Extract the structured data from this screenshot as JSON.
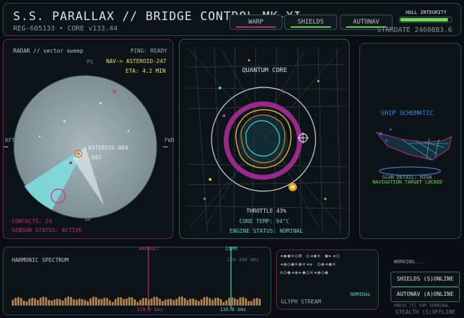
{
  "header": {
    "title": "S.S. PARALLAX // BRIDGE CONTROL MK-XI",
    "subtitle": "REG-605133 • CORE v133.44",
    "buttons": [
      {
        "label": "WARP",
        "color": "#c0306a"
      },
      {
        "label": "SHIELDS",
        "color": "#6bd65a"
      },
      {
        "label": "AUTONAV",
        "color": "#6bd65a"
      }
    ],
    "hull_label": "HULL INTEGRITY",
    "hull_level": 0.95,
    "stardate": "STARDATE 2460883.6"
  },
  "radar": {
    "title": "RADAR // sector sweep",
    "ping": "PING: READY",
    "nav": "NAV-> ASTEROID-247",
    "eta": "ETA: 4.2 MIN",
    "target_a": "ASTEROID-869",
    "target_b": "-507",
    "aft": "AFT",
    "fwd": "FWD",
    "ps": "PS",
    "sp": "SP",
    "contacts": "CONTACTS: 24",
    "sensor_status": "SENSOR STATUS: ACTIVE"
  },
  "core": {
    "title": "QUANTUM CORE",
    "throttle": "THROTTLE 43%",
    "temp": "CORE TEMP: 94°C",
    "engine": "ENGINE STATUS: NOMINAL"
  },
  "schematic": {
    "title": "SHIP SCHEMATIC",
    "scan": "SCAN DETAIL: HIGH",
    "nav_locked": "NAVIGATION TARGET LOCKED"
  },
  "spectrum": {
    "title": "HARMONIC SPECTRUM",
    "range": "120-300 GHz",
    "anomaly": "ANOMALY",
    "anomaly_freq": "129.0 GHz",
    "comm": "COMM",
    "comm_freq": "135.8 GHz"
  },
  "glyph": {
    "title": "GLYPH STREAM",
    "status": "NOMINAL",
    "row1": "◂▪◆✕◇⊗ ◇◂▪✕ ◆▸◂◇",
    "row2": "◂◈◇◆✕◈✕◂▸ ◇◈◂◆✕",
    "row3": "✕◇◆◂◈▸◆◇✕◂◈◇◆"
  },
  "side": {
    "overlay": "WORKING...",
    "shields_btn": "SHIELDS (S)ONLINE",
    "autonav_btn": "AUTONAV (A)ONLINE",
    "hint": "PRESS [T] FOR TERMINAL",
    "stealth": "STEALTH (S)OFFLINE"
  },
  "colors": {
    "accent_magenta": "#c0306a",
    "accent_green": "#6bd65a",
    "accent_cyan": "#5ad6d6",
    "accent_orange": "#e0a040"
  }
}
